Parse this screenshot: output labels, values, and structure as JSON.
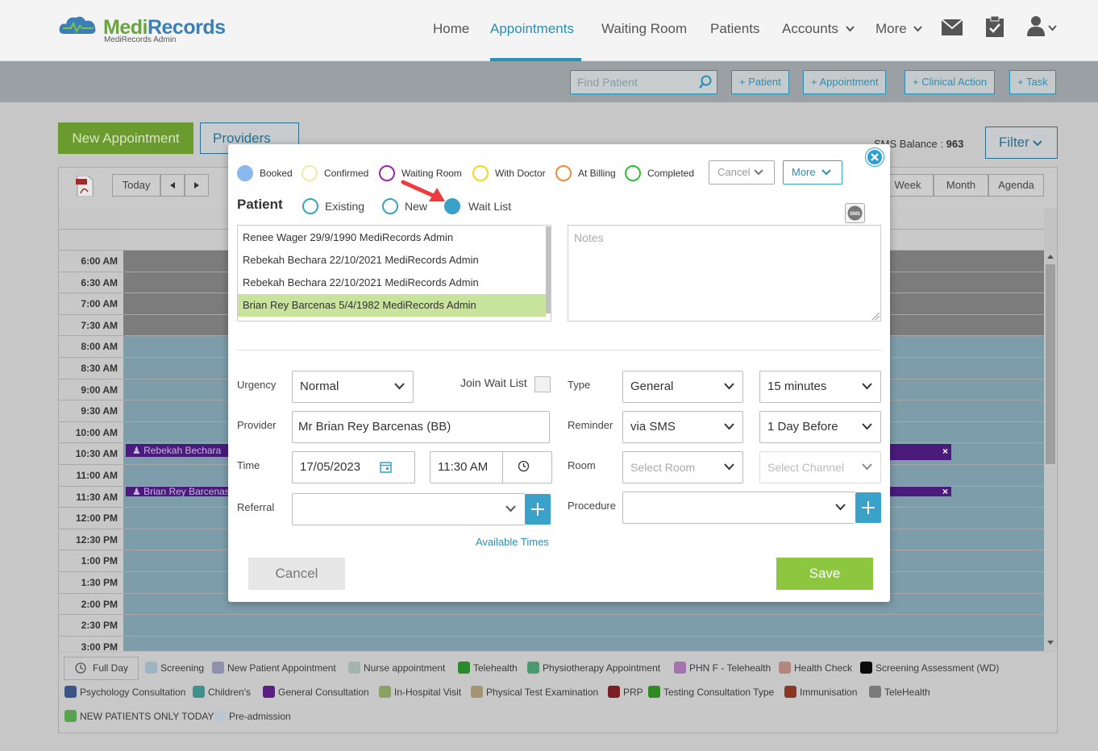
{
  "header": {
    "logo": "MediRecords",
    "logo_part1": "Medi",
    "logo_part2": "Records",
    "subtitle": "MediRecords Admin",
    "nav": [
      "Home",
      "Appointments",
      "Waiting Room",
      "Patients",
      "Accounts",
      "More"
    ],
    "active_nav": "Appointments"
  },
  "toolbar": {
    "search_placeholder": "Find Patient",
    "add_patient": "+ Patient",
    "add_appointment": "+ Appointment",
    "add_clinical_action": "+ Clinical Action",
    "add_task": "+ Task"
  },
  "page": {
    "new_appointment": "New Appointment",
    "providers": "Providers",
    "sms_balance_label": "SMS Balance : ",
    "sms_balance_value": "963",
    "filter": "Filter"
  },
  "calendar": {
    "today": "Today",
    "views": [
      "Week",
      "Month",
      "Agenda"
    ],
    "times": [
      "6:00 AM",
      "6:30 AM",
      "7:00 AM",
      "7:30 AM",
      "8:00 AM",
      "8:30 AM",
      "9:00 AM",
      "9:30 AM",
      "10:00 AM",
      "10:30 AM",
      "11:00 AM",
      "11:30 AM",
      "12:00 PM",
      "12:30 PM",
      "1:00 PM",
      "1:30 PM",
      "2:00 PM",
      "2:30 PM",
      "3:00 PM"
    ],
    "appointments": [
      {
        "label": "Rebekah Bechara"
      },
      {
        "label": "Brian Rey Barcenas"
      }
    ]
  },
  "legend": {
    "full_day": "Full Day",
    "items": [
      {
        "label": "Screening",
        "color": "#9fb3c0"
      },
      {
        "label": "New Patient Appointment",
        "color": "#8f8fae"
      },
      {
        "label": "Nurse appointment",
        "color": "#a3b3ad"
      },
      {
        "label": "Telehealth",
        "color": "#2c8a2c"
      },
      {
        "label": "Physiotherapy Appointment",
        "color": "#4c9a72"
      },
      {
        "label": "PHN F - Telehealth",
        "color": "#a373ae"
      },
      {
        "label": "Health Check",
        "color": "#b3867f"
      },
      {
        "label": "Screening Assessment (WD)",
        "color": "#0a0a0a"
      },
      {
        "label": "Psychology Consultation",
        "color": "#3a5585"
      },
      {
        "label": "Children's",
        "color": "#3f918d"
      },
      {
        "label": "General Consultation",
        "color": "#57207e"
      },
      {
        "label": "In-Hospital Visit",
        "color": "#8aa264"
      },
      {
        "label": "Physical Test Examination",
        "color": "#a39474"
      },
      {
        "label": "PRP",
        "color": "#7a1f24"
      },
      {
        "label": "Testing Consultation Type",
        "color": "#2f8a22"
      },
      {
        "label": "Immunisation",
        "color": "#8a3820"
      },
      {
        "label": "TeleHealth",
        "color": "#7a7a7a"
      },
      {
        "label": "NEW PATIENTS ONLY TODAY",
        "color": "#56a450"
      },
      {
        "label": "Pre-admission",
        "color": "#bcc6cf"
      }
    ]
  },
  "modal": {
    "statuses": [
      {
        "label": "Booked",
        "color": "#8ab8ef",
        "filled": true
      },
      {
        "label": "Confirmed",
        "color": "#eaf0a8"
      },
      {
        "label": "Waiting Room",
        "color": "#9b27b0"
      },
      {
        "label": "With Doctor",
        "color": "#f0d81c"
      },
      {
        "label": "At Billing",
        "color": "#f08a3c"
      },
      {
        "label": "Completed",
        "color": "#2fbf2f"
      }
    ],
    "cancel_dropdown": "Cancel",
    "more_dropdown": "More",
    "patient_label": "Patient",
    "patient_modes": [
      "Existing",
      "New",
      "Wait List"
    ],
    "selected_mode": "Wait List",
    "patients": [
      "Renee Wager 29/9/1990 MediRecords Admin",
      "Rebekah Bechara 22/10/2021 MediRecords Admin",
      "Rebekah Bechara 22/10/2021 MediRecords Admin",
      "Brian Rey Barcenas 5/4/1982 MediRecords Admin"
    ],
    "selected_patient_index": 3,
    "notes_placeholder": "Notes",
    "urgency_label": "Urgency",
    "urgency_value": "Normal",
    "join_wait_list_label": "Join Wait List",
    "type_label": "Type",
    "type_value": "General",
    "duration_value": "15 minutes",
    "provider_label": "Provider",
    "provider_value": "Mr Brian Rey Barcenas (BB)",
    "reminder_label": "Reminder",
    "reminder_value": "via SMS",
    "reminder_when": "1 Day Before",
    "time_label": "Time",
    "date_value": "17/05/2023",
    "time_value": "11:30 AM",
    "room_label": "Room",
    "room_placeholder": "Select Room",
    "channel_placeholder": "Select Channel",
    "referral_label": "Referral",
    "procedure_label": "Procedure",
    "available_times": "Available Times",
    "cancel": "Cancel",
    "save": "Save"
  }
}
